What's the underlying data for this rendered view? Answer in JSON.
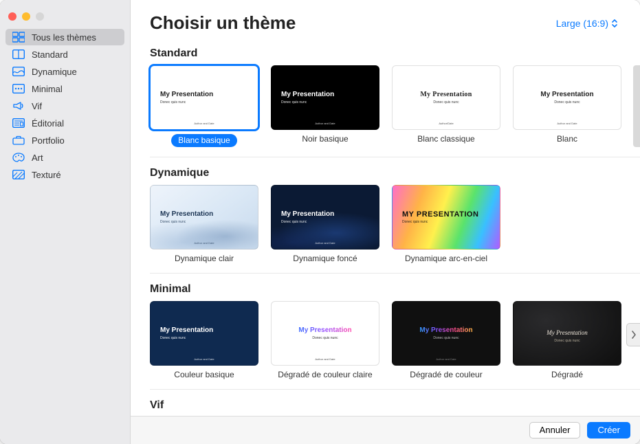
{
  "header": {
    "title": "Choisir un thème",
    "aspect_label": "Large (16:9)"
  },
  "sidebar": {
    "items": [
      {
        "label": "Tous les thèmes",
        "icon": "grid-all"
      },
      {
        "label": "Standard",
        "icon": "grid"
      },
      {
        "label": "Dynamique",
        "icon": "wave"
      },
      {
        "label": "Minimal",
        "icon": "dots"
      },
      {
        "label": "Vif",
        "icon": "megaphone"
      },
      {
        "label": "Éditorial",
        "icon": "news"
      },
      {
        "label": "Portfolio",
        "icon": "briefcase"
      },
      {
        "label": "Art",
        "icon": "palette"
      },
      {
        "label": "Texturé",
        "icon": "texture"
      }
    ]
  },
  "sections": {
    "standard": {
      "title": "Standard",
      "themes": [
        {
          "label": "Blanc basique"
        },
        {
          "label": "Noir basique"
        },
        {
          "label": "Blanc classique"
        },
        {
          "label": "Blanc"
        }
      ]
    },
    "dynamique": {
      "title": "Dynamique",
      "themes": [
        {
          "label": "Dynamique clair"
        },
        {
          "label": "Dynamique foncé"
        },
        {
          "label": "Dynamique arc-en-ciel"
        }
      ]
    },
    "minimal": {
      "title": "Minimal",
      "themes": [
        {
          "label": "Couleur basique"
        },
        {
          "label": "Dégradé de couleur claire"
        },
        {
          "label": "Dégradé de couleur"
        },
        {
          "label": "Dégradé"
        }
      ]
    },
    "vif": {
      "title": "Vif"
    }
  },
  "thumb": {
    "title": "My Presentation",
    "title_caps": "MY PRESENTATION",
    "sub": "Donec quis nunc",
    "author": "Author and Date",
    "author_short": "Author/Date"
  },
  "footer": {
    "cancel": "Annuler",
    "create": "Créer"
  }
}
